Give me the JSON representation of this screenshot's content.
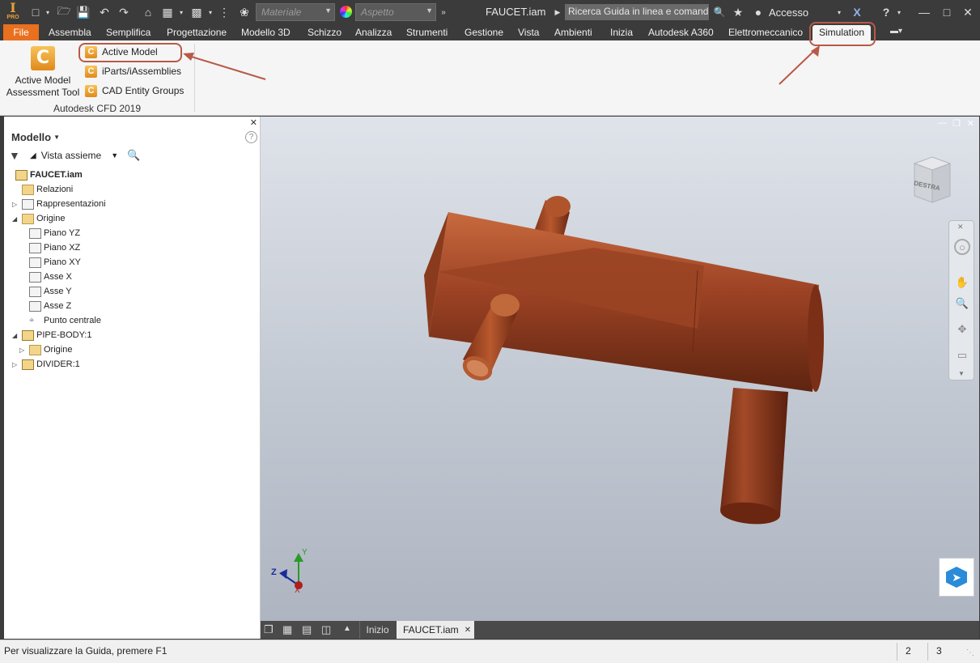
{
  "app": {
    "logo_label": "PRO",
    "title": "FAUCET.iam",
    "search_placeholder": "Ricerca Guida in linea e comand",
    "sign_in": "Accesso"
  },
  "quick_access": {
    "material_placeholder": "Materiale",
    "appearance_placeholder": "Aspetto"
  },
  "menu": {
    "file": "File",
    "tabs": [
      "Assembla",
      "Semplifica",
      "Progettazione",
      "Modello 3D",
      "Schizzo",
      "Analizza",
      "Strumenti",
      "Gestione",
      "Vista",
      "Ambienti",
      "Inizia",
      "Autodesk A360",
      "Elettromeccanico",
      "Simulation"
    ],
    "active_tab": "Simulation"
  },
  "ribbon": {
    "big_button_line1": "Active Model",
    "big_button_line2": "Assessment Tool",
    "items": [
      "Active Model",
      "iParts/iAssemblies",
      "CAD Entity Groups"
    ],
    "panel_title": "Autodesk CFD 2019"
  },
  "browser": {
    "title": "Modello",
    "view_label": "Vista assieme",
    "tree": [
      {
        "label": "FAUCET.iam",
        "level": 0,
        "icon": "assembly-icon",
        "bold": true
      },
      {
        "label": "Relazioni",
        "level": 1,
        "icon": "folder-icon"
      },
      {
        "label": "Rappresentazioni",
        "level": 1,
        "icon": "representations-icon",
        "expand": "collapsed"
      },
      {
        "label": "Origine",
        "level": 1,
        "icon": "folder-open-icon",
        "expand": "expanded"
      },
      {
        "label": "Piano YZ",
        "level": 2,
        "icon": "plane-icon"
      },
      {
        "label": "Piano XZ",
        "level": 2,
        "icon": "plane-icon"
      },
      {
        "label": "Piano XY",
        "level": 2,
        "icon": "plane-icon"
      },
      {
        "label": "Asse X",
        "level": 2,
        "icon": "axis-icon"
      },
      {
        "label": "Asse Y",
        "level": 2,
        "icon": "axis-icon"
      },
      {
        "label": "Asse Z",
        "level": 2,
        "icon": "axis-icon"
      },
      {
        "label": "Punto centrale",
        "level": 2,
        "icon": "point-icon"
      },
      {
        "label": "PIPE-BODY:1",
        "level": 1,
        "icon": "part-icon",
        "expand": "expanded"
      },
      {
        "label": "Origine",
        "level": 2,
        "icon": "folder-icon",
        "expand": "collapsed"
      },
      {
        "label": "DIVIDER:1",
        "level": 1,
        "icon": "part-icon",
        "expand": "collapsed"
      }
    ]
  },
  "viewport": {
    "viewcube_label": "DESTRA",
    "axis_labels": {
      "x": "X",
      "y": "Y",
      "z": "Z"
    }
  },
  "doc_tabs": {
    "home": "Inizio",
    "active": "FAUCET.iam"
  },
  "status": {
    "message": "Per visualizzare la Guida, premere F1",
    "count1": "2",
    "count2": "3"
  },
  "colors": {
    "file_tab": "#e8701e",
    "annotation": "#b85a48",
    "part": "#8e3a1c",
    "menubar": "#3b3b3b"
  }
}
